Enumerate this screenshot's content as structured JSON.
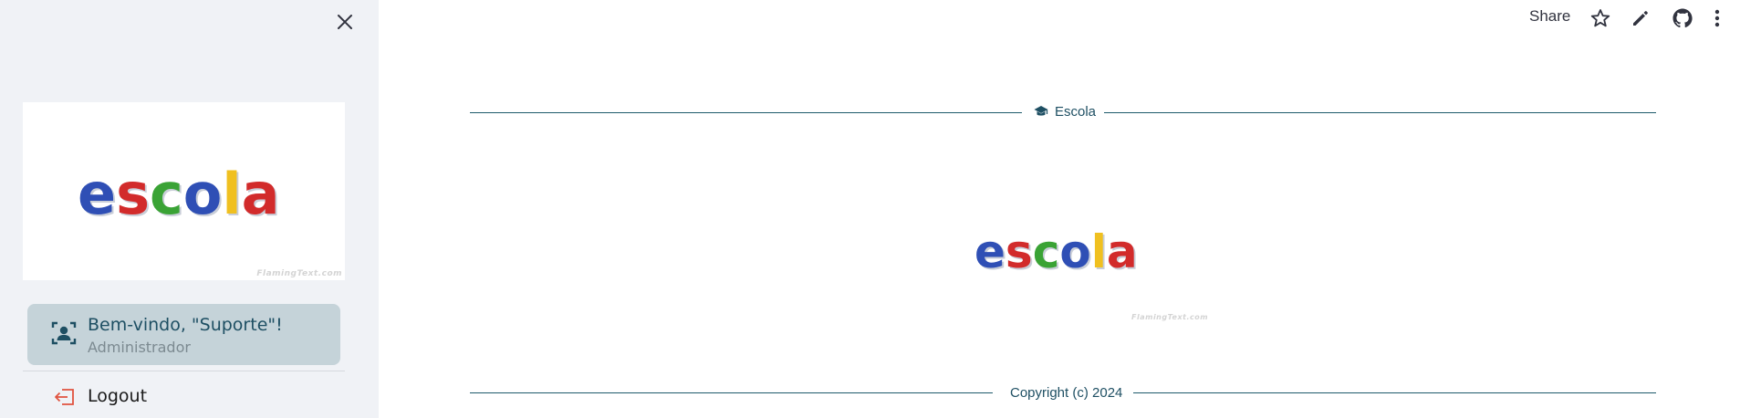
{
  "sidebar": {
    "logo_text": "escola",
    "logo_watermark": "FlamingText.com",
    "user_card": {
      "welcome": "Bem-vindo, \"Suporte\"!",
      "role": "Administrador"
    },
    "logout_label": "Logout"
  },
  "toolbar": {
    "share_label": "Share",
    "icons": [
      "star-icon",
      "edit-icon",
      "github-icon",
      "more-vert-icon"
    ]
  },
  "main": {
    "header_label": "Escola",
    "header_icon": "graduation-cap-icon",
    "logo_text": "escola",
    "logo_watermark": "FlamingText.com",
    "footer_label": "Copyright (c) 2024"
  },
  "colors": {
    "sidebar_bg": "#f0f2f6",
    "accent": "#1e5a6b",
    "user_card_bg": "#c5d3d9",
    "logout_icon": "#e0533f",
    "logo_blue": "#2f4fb5",
    "logo_red": "#d22b2b",
    "logo_green": "#3aa335",
    "logo_yellow": "#f0c020"
  }
}
